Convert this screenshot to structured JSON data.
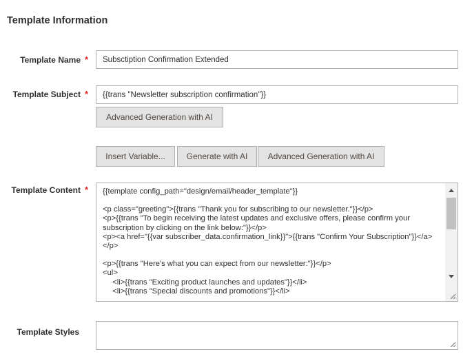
{
  "section": {
    "title": "Template Information"
  },
  "fields": {
    "template_name": {
      "label": "Template Name",
      "value": "Subsctiption Confirmation Extended"
    },
    "template_subject": {
      "label": "Template Subject",
      "value": "{{trans \"Newsletter subscription confirmation\"}}",
      "ai_button": "Advanced Generation with AI"
    },
    "template_content": {
      "label": "Template Content",
      "toolbar": {
        "insert_variable": "Insert Variable...",
        "generate_ai": "Generate with AI",
        "advanced_ai": "Advanced Generation with AI"
      },
      "lines": [
        "{{template config_path=\"design/email/header_template\"}}",
        "",
        "<p class=\"greeting\">{{trans \"Thank you for subscribing to our newsletter.\"}}</p>",
        "<p>{{trans \"To begin receiving the latest updates and exclusive offers, please confirm your subscription by clicking on the link below:\"}}</p>",
        "<p><a href=\"{{var subscriber_data.confirmation_link}}\">{{trans \"Confirm Your Subscription\"}}</a></p>",
        "",
        "<p>{{trans \"Here's what you can expect from our newsletter:\"}}</p>",
        "<ul>",
        "  <li>{{trans \"Exciting product launches and updates\"}}</li>",
        "  <li>{{trans \"Special discounts and promotions\"}}</li>"
      ]
    },
    "template_styles": {
      "label": "Template Styles",
      "value": ""
    }
  },
  "colors": {
    "required": "#e22626",
    "border": "#adadad",
    "button_bg": "#e3e3e3"
  }
}
